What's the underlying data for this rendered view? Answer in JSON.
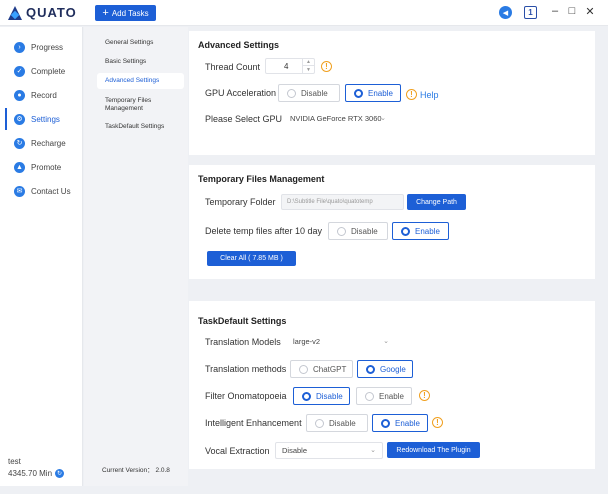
{
  "app": {
    "name": "QUATO"
  },
  "header": {
    "add_tasks_label": "Add Tasks",
    "calendar_icon_text": "1",
    "window_controls": {
      "minimize": "–",
      "maximize": "□",
      "close": "✕"
    }
  },
  "sidebar": {
    "items": [
      {
        "label": "Progress",
        "icon": "progress-icon"
      },
      {
        "label": "Complete",
        "icon": "complete-icon"
      },
      {
        "label": "Record",
        "icon": "record-icon"
      },
      {
        "label": "Settings",
        "icon": "settings-icon",
        "active": true
      },
      {
        "label": "Recharge",
        "icon": "recharge-icon"
      },
      {
        "label": "Promote",
        "icon": "promote-icon"
      },
      {
        "label": "Contact Us",
        "icon": "contact-icon"
      }
    ],
    "user": {
      "name": "test",
      "minutes": "4345.70 Min"
    }
  },
  "subnav": {
    "items": [
      "General Settings",
      "Basic Settings",
      "Advanced Settings",
      "Temporary Files Management",
      "TaskDefault Settings"
    ],
    "active": "Advanced Settings",
    "version": "Current Version： 2.0.8"
  },
  "advanced": {
    "title": "Advanced Settings",
    "thread_count_label": "Thread Count",
    "thread_count_value": "4",
    "gpu_accel_label": "GPU Acceleration",
    "gpu_disable": "Disable",
    "gpu_enable": "Enable",
    "help_label": "Help",
    "gpu_select_label": "Please Select GPU",
    "gpu_select_value": "NVIDIA GeForce RTX 3060"
  },
  "temp": {
    "title": "Temporary Files Management",
    "folder_label": "Temporary Folder",
    "folder_value": "D:\\Subtitle File\\quato\\quatotemp",
    "change_path": "Change Path",
    "delete_label": "Delete temp files after 10 day",
    "delete_disable": "Disable",
    "delete_enable": "Enable",
    "clear_all": "Clear All  ( 7.85 MB )"
  },
  "taskdefault": {
    "title": "TaskDefault Settings",
    "translation_models_label": "Translation Models",
    "translation_models_value": "large-v2",
    "translation_methods_label": "Translation methods",
    "method_chatgpt": "ChatGPT",
    "method_google": "Google",
    "filter_label": "Filter Onomatopoeia",
    "filter_disable": "Disable",
    "filter_enable": "Enable",
    "enhance_label": "Intelligent Enhancement",
    "enhance_disable": "Disable",
    "enhance_enable": "Enable",
    "vocal_label": "Vocal Extraction",
    "vocal_value": "Disable",
    "redownload": "Redownload The Plugin"
  }
}
